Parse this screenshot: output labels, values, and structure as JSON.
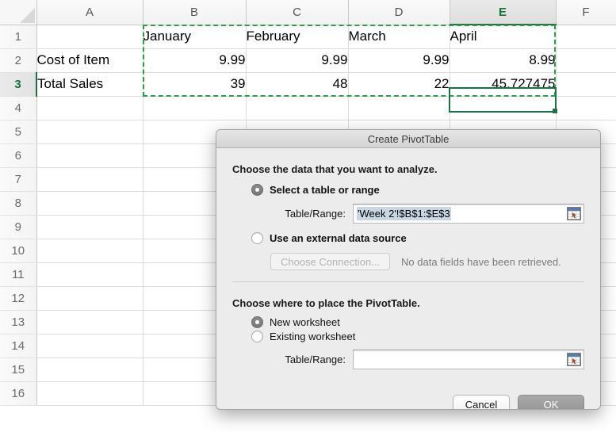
{
  "spreadsheet": {
    "columns": [
      "A",
      "B",
      "C",
      "D",
      "E",
      "F"
    ],
    "active_column": "E",
    "rows": [
      "1",
      "2",
      "3",
      "4",
      "5",
      "6",
      "7",
      "8",
      "9",
      "10",
      "11",
      "12",
      "13",
      "14",
      "15",
      "16"
    ],
    "active_row": "3",
    "cells": [
      {
        "row": "1",
        "A": "",
        "B": "January",
        "C": "February",
        "D": "March",
        "E": "April",
        "F": "",
        "align": [
          "txt",
          "txt",
          "txt",
          "txt",
          "txt",
          "txt"
        ]
      },
      {
        "row": "2",
        "A": "Cost of Item",
        "B": "9.99",
        "C": "9.99",
        "D": "9.99",
        "E": "8.99",
        "F": "",
        "align": [
          "txt",
          "num",
          "num",
          "num",
          "num",
          "txt"
        ]
      },
      {
        "row": "3",
        "A": "Total Sales",
        "B": "39",
        "C": "48",
        "D": "22",
        "E": "45.727475",
        "F": "",
        "align": [
          "txt",
          "num",
          "num",
          "num",
          "num",
          "txt"
        ]
      }
    ],
    "selection_range": "B1:E3",
    "active_cell": "E3",
    "accent_color": "#1e7145",
    "marching_ants_color": "#2e9e44"
  },
  "dialog": {
    "title": "Create PivotTable",
    "analyze_section": {
      "heading": "Choose the data that you want to analyze.",
      "option_table_range": "Select a table or range",
      "option_table_range_selected": true,
      "table_range_label": "Table/Range:",
      "table_range_value": "'Week 2'!$B$1:$E$3",
      "table_range_placeholder": "",
      "option_external": "Use an external data source",
      "option_external_selected": false,
      "choose_connection_label": "Choose Connection...",
      "connection_note": "No data fields have been retrieved."
    },
    "place_section": {
      "heading": "Choose where to place the PivotTable.",
      "option_new_worksheet": "New worksheet",
      "option_new_worksheet_selected": true,
      "option_existing_worksheet": "Existing worksheet",
      "option_existing_worksheet_selected": false,
      "table_range_label": "Table/Range:",
      "table_range_value": "",
      "table_range_placeholder": ""
    },
    "buttons": {
      "cancel": "Cancel",
      "ok": "OK"
    }
  }
}
